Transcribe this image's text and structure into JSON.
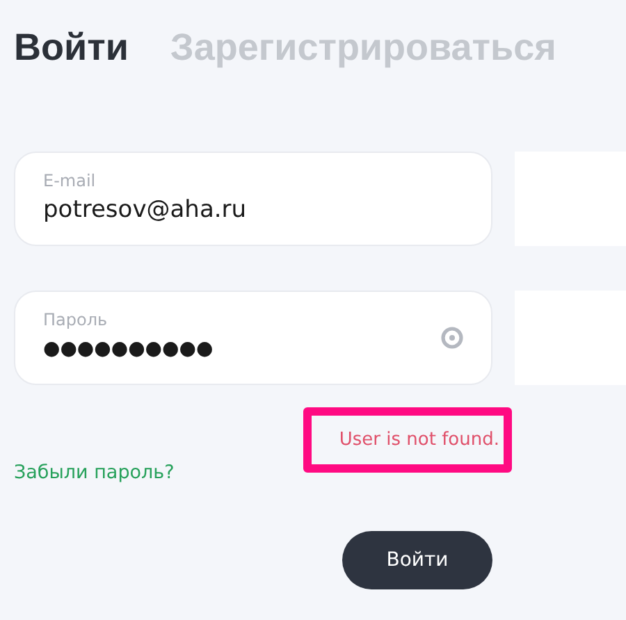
{
  "tabs": [
    {
      "label": "Войти",
      "selected": true
    },
    {
      "label": "Зарегистрироваться",
      "selected": false
    }
  ],
  "fields": [
    {
      "kind": "text",
      "label": "E-mail",
      "value": "potresov@aha.ru"
    },
    {
      "kind": "password",
      "label": "Пароль",
      "value": "●●●●●●●●●●"
    }
  ],
  "error": {
    "message": "User is not found."
  },
  "forgot_link": "Забыли пароль?",
  "submit_button": "Войти"
}
